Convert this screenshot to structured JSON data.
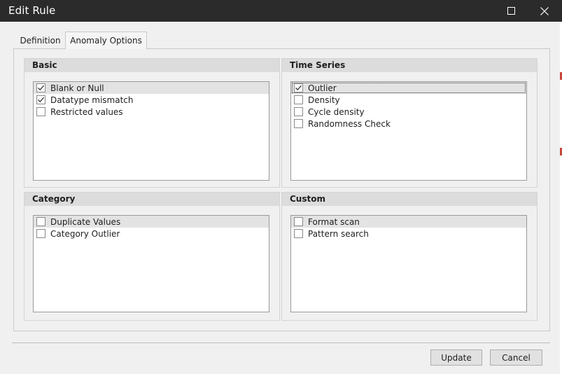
{
  "window": {
    "title": "Edit Rule",
    "maximize_icon": "maximize-icon",
    "close_icon": "close-icon"
  },
  "tabs": [
    {
      "label": "Definition",
      "active": false
    },
    {
      "label": "Anomaly Options",
      "active": true
    }
  ],
  "groups": {
    "basic": {
      "title": "Basic",
      "items": [
        {
          "label": "Blank or Null",
          "checked": true,
          "selected": true
        },
        {
          "label": "Datatype mismatch",
          "checked": true,
          "selected": false
        },
        {
          "label": "Restricted values",
          "checked": false,
          "selected": false
        }
      ]
    },
    "time_series": {
      "title": "Time Series",
      "items": [
        {
          "label": "Outlier",
          "checked": true,
          "selected": true
        },
        {
          "label": "Density",
          "checked": false,
          "selected": false
        },
        {
          "label": "Cycle density",
          "checked": false,
          "selected": false
        },
        {
          "label": "Randomness Check",
          "checked": false,
          "selected": false
        }
      ]
    },
    "category": {
      "title": "Category",
      "items": [
        {
          "label": "Duplicate Values",
          "checked": false,
          "selected": true
        },
        {
          "label": "Category Outlier",
          "checked": false,
          "selected": false
        }
      ]
    },
    "custom": {
      "title": "Custom",
      "items": [
        {
          "label": "Format scan",
          "checked": false,
          "selected": true
        },
        {
          "label": "Pattern search",
          "checked": false,
          "selected": false
        }
      ]
    }
  },
  "buttons": {
    "update": "Update",
    "cancel": "Cancel"
  },
  "colors": {
    "titlebar": "#2b2b2b",
    "window_bg": "#f0f0f0",
    "group_header": "#dcdcdc",
    "selected_row": "#e3e3e3"
  }
}
